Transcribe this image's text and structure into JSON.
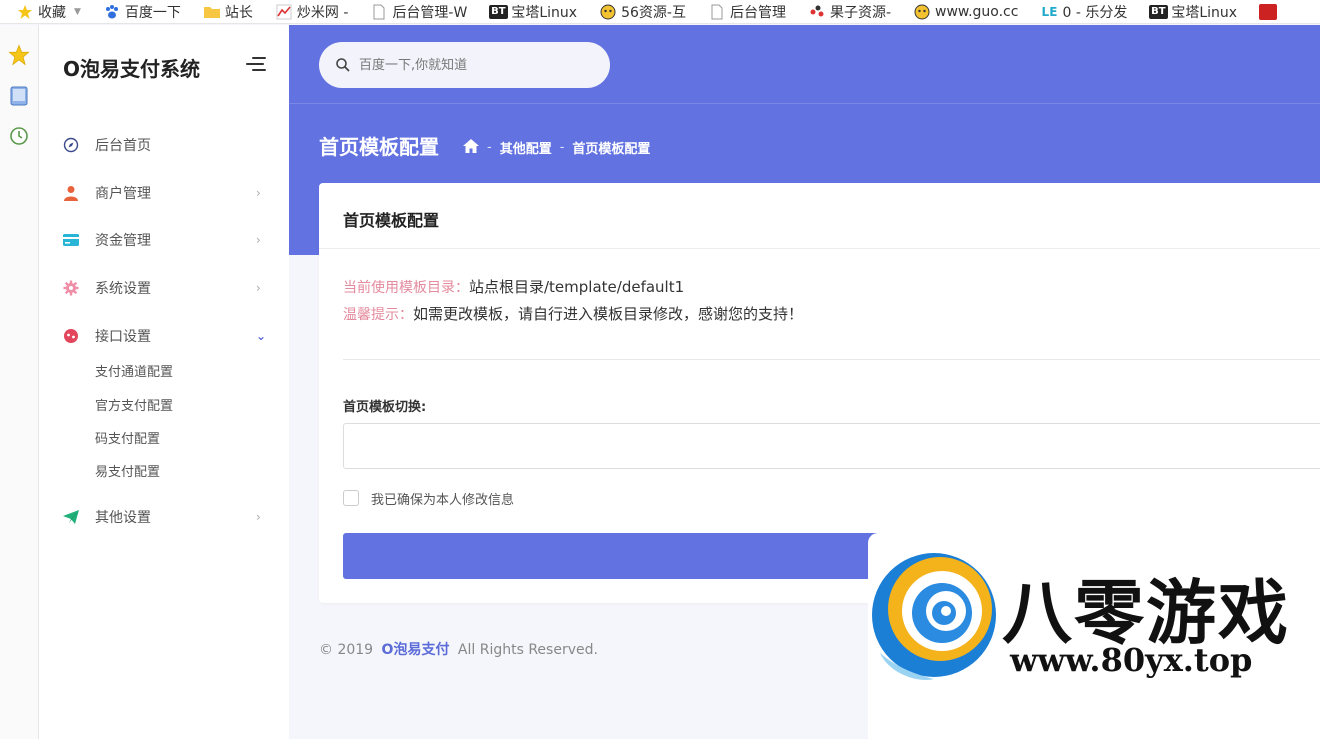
{
  "bookmarks": [
    {
      "label": "收藏",
      "icon": "star-icon"
    },
    {
      "label": "百度一下",
      "icon": "baidu-paw-icon"
    },
    {
      "label": "站长",
      "icon": "folder-icon"
    },
    {
      "label": "炒米网 -",
      "icon": "chart-icon"
    },
    {
      "label": "后台管理-W",
      "icon": "page-icon"
    },
    {
      "label": "宝塔Linux",
      "icon": "bt-icon"
    },
    {
      "label": "56资源-互",
      "icon": "face-icon"
    },
    {
      "label": "后台管理",
      "icon": "page-icon"
    },
    {
      "label": "果子资源-",
      "icon": "dots-icon"
    },
    {
      "label": "www.guo.cc",
      "icon": "face-icon"
    },
    {
      "label": "0 - 乐分发",
      "icon": "le-icon"
    },
    {
      "label": "宝塔Linux",
      "icon": "bt-icon"
    }
  ],
  "bookmark_badges": {
    "bt": "BT",
    "le": "LE"
  },
  "sidebar": {
    "brand": "O泡易支付系统",
    "items": [
      {
        "label": "后台首页",
        "icon": "compass-icon",
        "has_arrow": false
      },
      {
        "label": "商户管理",
        "icon": "user-icon",
        "has_arrow": true
      },
      {
        "label": "资金管理",
        "icon": "card-icon",
        "has_arrow": true
      },
      {
        "label": "系统设置",
        "icon": "gear-icon",
        "has_arrow": true
      },
      {
        "label": "接口设置",
        "icon": "interface-icon",
        "has_arrow": true,
        "expanded": true
      },
      {
        "label": "其他设置",
        "icon": "send-icon",
        "has_arrow": true
      }
    ],
    "subitems": [
      "支付通道配置",
      "官方支付配置",
      "码支付配置",
      "易支付配置"
    ]
  },
  "search": {
    "placeholder": "百度一下,你就知道"
  },
  "page": {
    "title": "首页模板配置",
    "breadcrumb": [
      "其他配置",
      "首页模板配置"
    ],
    "breadcrumb_sep": "-"
  },
  "card": {
    "title": "首页模板配置",
    "current_key": "当前使用模板目录：",
    "current_value": "站点根目录/template/default1",
    "tip_key": "温馨提示：",
    "tip_value": "如需更改模板，请自行进入模板目录修改，感谢您的支持！",
    "field_label": "首页模板切换:",
    "field_value": "",
    "checkbox_label": "我已确保为本人修改信息",
    "submit_label": ""
  },
  "footer": {
    "copyright": "© 2019",
    "brand": "O泡易支付",
    "rights": "All Rights Reserved."
  },
  "watermark": {
    "cn": "八零游戏",
    "url": "www.80yx.top"
  },
  "colors": {
    "accent": "#6372e1",
    "user_icon": "#e8623c",
    "card_icon": "#29b6d6",
    "gear_icon": "#f08ea8",
    "interface_icon": "#e2455c",
    "send_icon": "#21b07a",
    "tip_key": "#e48b9e"
  }
}
